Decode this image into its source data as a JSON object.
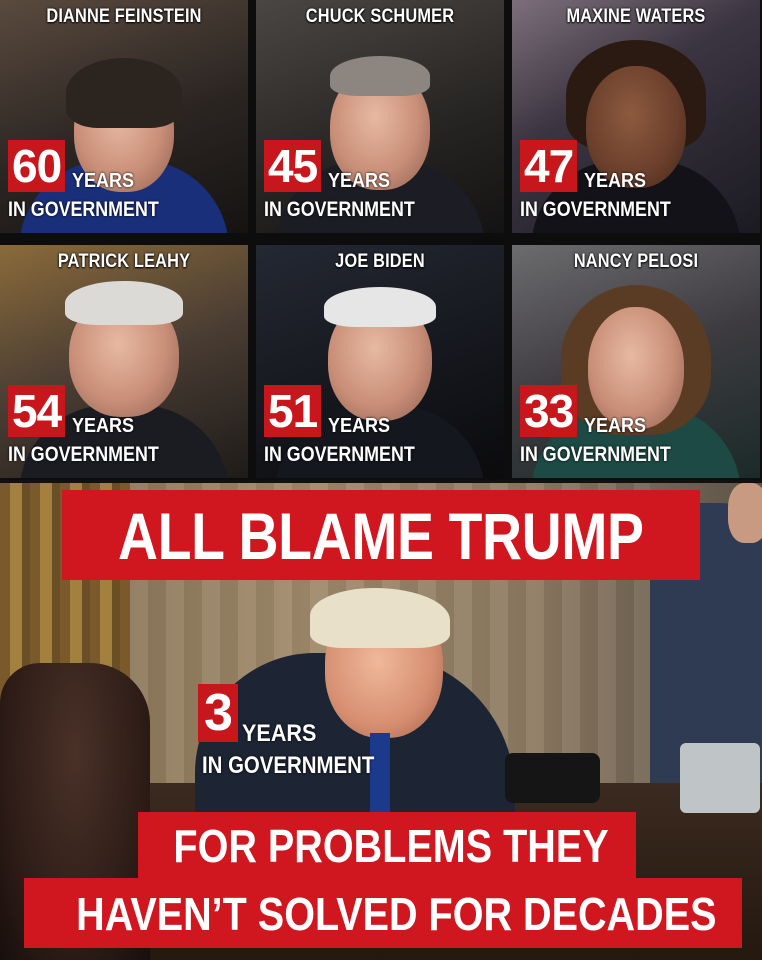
{
  "politicians": [
    {
      "name": "DIANNE FEINSTEIN",
      "years": "60",
      "unit": "YEARS",
      "sub": "IN GOVERNMENT"
    },
    {
      "name": "CHUCK SCHUMER",
      "years": "45",
      "unit": "YEARS",
      "sub": "IN GOVERNMENT"
    },
    {
      "name": "MAXINE WATERS",
      "years": "47",
      "unit": "YEARS",
      "sub": "IN GOVERNMENT"
    },
    {
      "name": "PATRICK LEAHY",
      "years": "54",
      "unit": "YEARS",
      "sub": "IN GOVERNMENT"
    },
    {
      "name": "JOE BIDEN",
      "years": "51",
      "unit": "YEARS",
      "sub": "IN GOVERNMENT"
    },
    {
      "name": "NANCY PELOSI",
      "years": "33",
      "unit": "YEARS",
      "sub": "IN GOVERNMENT"
    }
  ],
  "headline": "ALL BLAME TRUMP",
  "trump": {
    "years": "3",
    "unit": "YEARS",
    "sub": "IN GOVERNMENT"
  },
  "tagline": {
    "line1": "FOR PROBLEMS THEY",
    "line2": "HAVEN’T SOLVED FOR DECADES"
  },
  "colors": {
    "accent_red": "#d0161e",
    "text": "#ffffff"
  }
}
